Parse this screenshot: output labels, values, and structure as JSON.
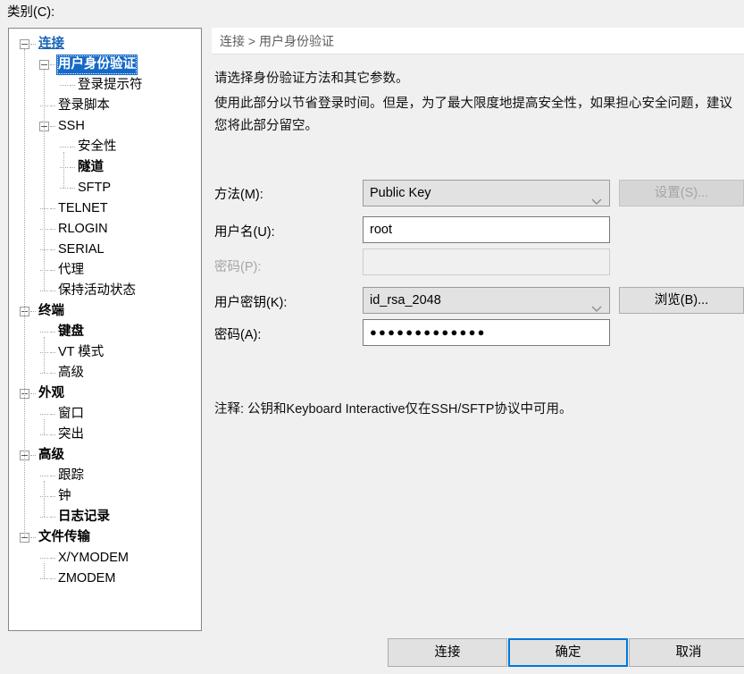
{
  "category_label": "类别(C):",
  "tree": {
    "nodes": [
      {
        "label": "连接",
        "depth": 0,
        "style": "link",
        "expander": true
      },
      {
        "label": "用户身份验证",
        "depth": 1,
        "style": "selected",
        "expander": true
      },
      {
        "label": "登录提示符",
        "depth": 2,
        "style": "normal",
        "expander": false
      },
      {
        "label": "登录脚本",
        "depth": 1,
        "style": "normal",
        "expander": false
      },
      {
        "label": "SSH",
        "depth": 1,
        "style": "normal",
        "expander": true
      },
      {
        "label": "安全性",
        "depth": 2,
        "style": "normal",
        "expander": false
      },
      {
        "label": "隧道",
        "depth": 2,
        "style": "bold",
        "expander": false
      },
      {
        "label": "SFTP",
        "depth": 2,
        "style": "normal",
        "expander": false
      },
      {
        "label": "TELNET",
        "depth": 1,
        "style": "normal",
        "expander": false
      },
      {
        "label": "RLOGIN",
        "depth": 1,
        "style": "normal",
        "expander": false
      },
      {
        "label": "SERIAL",
        "depth": 1,
        "style": "normal",
        "expander": false
      },
      {
        "label": "代理",
        "depth": 1,
        "style": "normal",
        "expander": false
      },
      {
        "label": "保持活动状态",
        "depth": 1,
        "style": "normal",
        "expander": false
      },
      {
        "label": "终端",
        "depth": 0,
        "style": "bold",
        "expander": true
      },
      {
        "label": "键盘",
        "depth": 1,
        "style": "bold",
        "expander": false
      },
      {
        "label": "VT 模式",
        "depth": 1,
        "style": "normal",
        "expander": false
      },
      {
        "label": "高级",
        "depth": 1,
        "style": "normal",
        "expander": false
      },
      {
        "label": "外观",
        "depth": 0,
        "style": "bold",
        "expander": true
      },
      {
        "label": "窗口",
        "depth": 1,
        "style": "normal",
        "expander": false
      },
      {
        "label": "突出",
        "depth": 1,
        "style": "normal",
        "expander": false
      },
      {
        "label": "高级",
        "depth": 0,
        "style": "bold",
        "expander": true
      },
      {
        "label": "跟踪",
        "depth": 1,
        "style": "normal",
        "expander": false
      },
      {
        "label": "钟",
        "depth": 1,
        "style": "normal",
        "expander": false
      },
      {
        "label": "日志记录",
        "depth": 1,
        "style": "bold",
        "expander": false
      },
      {
        "label": "文件传输",
        "depth": 0,
        "style": "bold",
        "expander": true
      },
      {
        "label": "X/YMODEM",
        "depth": 1,
        "style": "normal",
        "expander": false
      },
      {
        "label": "ZMODEM",
        "depth": 1,
        "style": "normal",
        "expander": false
      }
    ]
  },
  "breadcrumb": {
    "text": "连接 > 用户身份验证"
  },
  "description": {
    "line1": "请选择身份验证方法和其它参数。",
    "line2": "使用此部分以节省登录时间。但是，为了最大限度地提高安全性，如果担心安全问题，建议您将此部分留空。"
  },
  "form": {
    "method": {
      "label": "方法(M):",
      "value": "Public Key",
      "button_label": "设置(S)...",
      "button_enabled": false
    },
    "username": {
      "label": "用户名(U):",
      "value": "root"
    },
    "password": {
      "label": "密码(P):",
      "value": "",
      "enabled": false
    },
    "userkey": {
      "label": "用户密钥(K):",
      "value": "id_rsa_2048",
      "button_label": "浏览(B)...",
      "button_enabled": true
    },
    "passphrase": {
      "label": "密码(A):",
      "value": "●●●●●●●●●●●●●"
    }
  },
  "note": "注释: 公钥和Keyboard Interactive仅在SSH/SFTP协议中可用。",
  "footer": {
    "connect_label": "连接",
    "ok_label": "确定",
    "cancel_label": "取消"
  },
  "colors": {
    "selection": "#1569c7",
    "link": "#1763b5",
    "default_button_border": "#0078d7",
    "dialog_bg": "#f0f0f0"
  }
}
